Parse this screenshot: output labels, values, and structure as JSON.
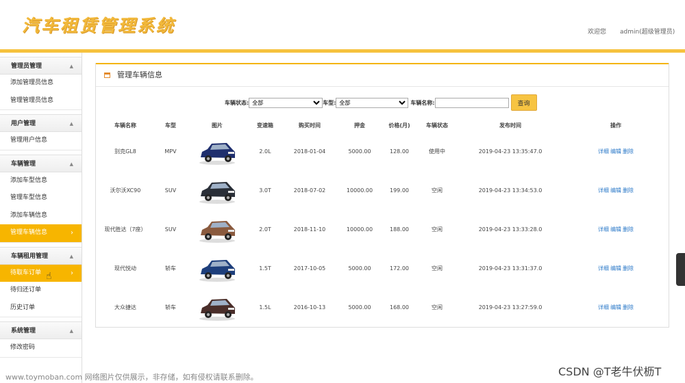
{
  "header": {
    "logo": "汽车租赁管理系统",
    "welcome": "欢迎您",
    "user": "admin(超级管理员)"
  },
  "sidebar": [
    {
      "title": "管理员管理",
      "items": [
        "添加管理员信息",
        "管理管理员信息"
      ]
    },
    {
      "title": "用户管理",
      "items": [
        "管理用户信息"
      ]
    },
    {
      "title": "车辆管理",
      "items": [
        "添加车型信息",
        "管理车型信息",
        "添加车辆信息",
        "管理车辆信息"
      ]
    },
    {
      "title": "车辆租用管理",
      "items": [
        "待取车订单",
        "待归还订单",
        "历史订单"
      ]
    },
    {
      "title": "系统管理",
      "items": [
        "修改密码"
      ]
    }
  ],
  "panel": {
    "title": "管理车辆信息",
    "search": {
      "status_label": "车辆状态:",
      "status_value": "全部",
      "type_label": "车型:",
      "type_value": "全部",
      "name_label": "车辆名称:",
      "name_value": "",
      "button": "查询"
    },
    "columns": [
      "车辆名称",
      "车型",
      "图片",
      "变速箱",
      "购买时间",
      "押金",
      "价格(月)",
      "车辆状态",
      "发布时间",
      "操作"
    ],
    "rows": [
      {
        "name": "别克GL8",
        "type": "MPV",
        "gearbox": "2.0L",
        "buy": "2018-01-04",
        "deposit": "5000.00",
        "price": "128.00",
        "status": "使用中",
        "publish": "2019-04-23 13:35:47.0",
        "car_color": "#1f2f6e"
      },
      {
        "name": "沃尔沃XC90",
        "type": "SUV",
        "gearbox": "3.0T",
        "buy": "2018-07-02",
        "deposit": "10000.00",
        "price": "199.00",
        "status": "空闲",
        "publish": "2019-04-23 13:34:53.0",
        "car_color": "#2a2f38"
      },
      {
        "name": "现代胜达（7座）",
        "type": "SUV",
        "gearbox": "2.0T",
        "buy": "2018-11-10",
        "deposit": "10000.00",
        "price": "188.00",
        "status": "空闲",
        "publish": "2019-04-23 13:33:28.0",
        "car_color": "#8a5a3e"
      },
      {
        "name": "现代悦动",
        "type": "轿车",
        "gearbox": "1.5T",
        "buy": "2017-10-05",
        "deposit": "5000.00",
        "price": "172.00",
        "status": "空闲",
        "publish": "2019-04-23 13:31:37.0",
        "car_color": "#1e3f7c"
      },
      {
        "name": "大众捷达",
        "type": "轿车",
        "gearbox": "1.5L",
        "buy": "2016-10-13",
        "deposit": "5000.00",
        "price": "168.00",
        "status": "空闲",
        "publish": "2019-04-23 13:27:59.0",
        "car_color": "#4a2e2a"
      }
    ],
    "ops": [
      "详细",
      "编辑",
      "删除"
    ]
  },
  "watermark": "www.toymoban.com 网络图片仅供展示，非存储，如有侵权请联系删除。",
  "csdn": "CSDN @T老牛伏枥T"
}
